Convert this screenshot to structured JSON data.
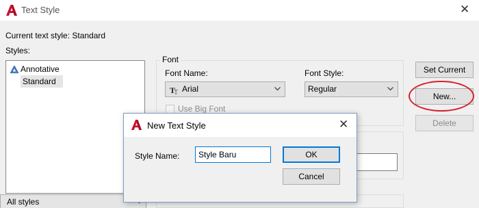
{
  "window": {
    "title": "Text Style",
    "close_glyph": "✕"
  },
  "current_style": {
    "label": "Current text style:",
    "value": "Standard"
  },
  "styles": {
    "label": "Styles:",
    "items": [
      {
        "label": "Annotative",
        "icon": "annotative-icon"
      },
      {
        "label": "Standard",
        "selected": true
      }
    ],
    "filter": "All styles"
  },
  "font": {
    "group_label": "Font",
    "name_label": "Font Name:",
    "name_value": "Arial",
    "style_label": "Font Style:",
    "style_value": "Regular",
    "big_font_label": "Use Big Font"
  },
  "buttons": {
    "set_current": "Set Current",
    "new": "New...",
    "delete": "Delete"
  },
  "dialog": {
    "title": "New Text Style",
    "field_label": "Style Name:",
    "field_value": "Style Baru",
    "ok": "OK",
    "cancel": "Cancel",
    "close_glyph": "✕"
  },
  "colors": {
    "autocad_red": "#c8102e",
    "highlight_ellipse": "#d6202a",
    "focus_blue": "#0078d7"
  }
}
